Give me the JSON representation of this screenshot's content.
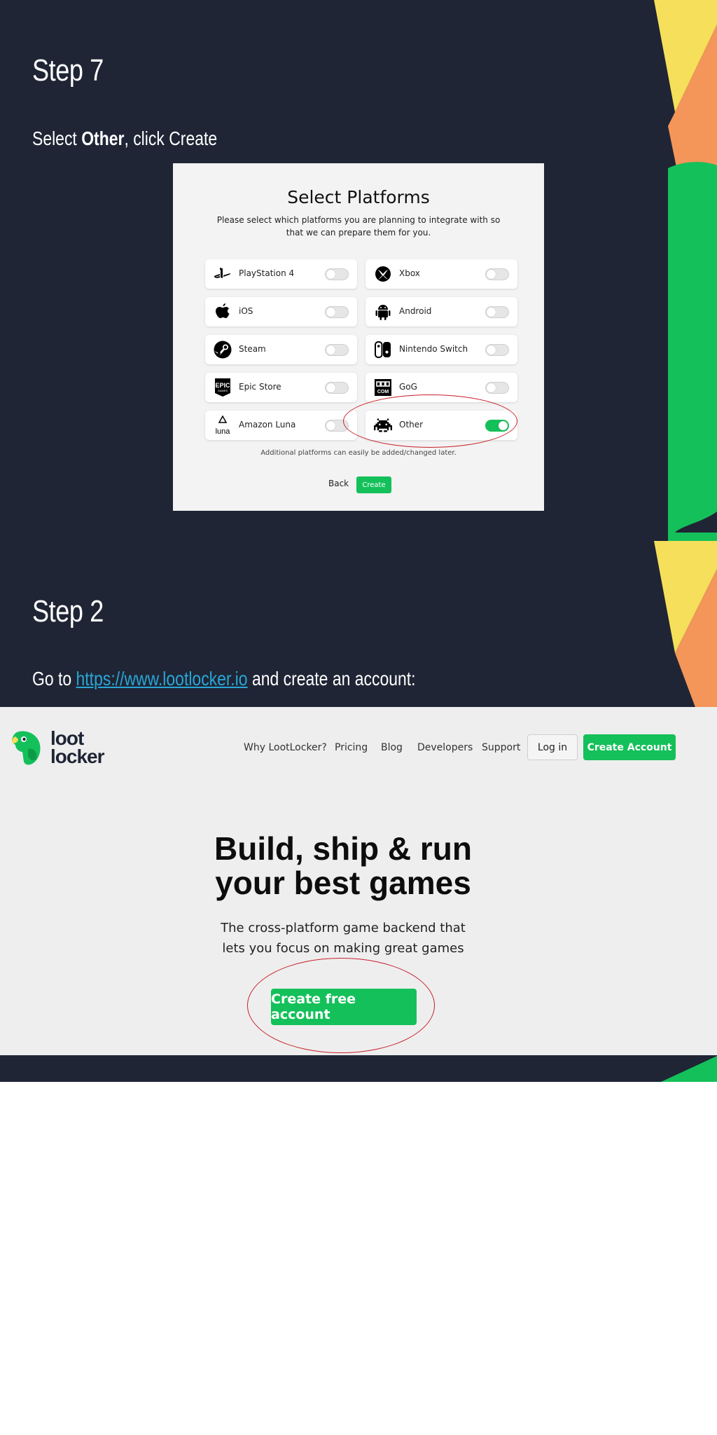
{
  "step7": {
    "title": "Step 7",
    "text_prefix": "Select ",
    "text_bold": "Other",
    "text_suffix": ", click Create",
    "panel": {
      "title": "Select Platforms",
      "description": "Please select which platforms you are planning to integrate with so that we can prepare them for you.",
      "platforms": [
        {
          "label": "PlayStation 4",
          "icon": "playstation-icon",
          "enabled": false
        },
        {
          "label": "Xbox",
          "icon": "xbox-icon",
          "enabled": false
        },
        {
          "label": "iOS",
          "icon": "apple-icon",
          "enabled": false
        },
        {
          "label": "Android",
          "icon": "android-icon",
          "enabled": false
        },
        {
          "label": "Steam",
          "icon": "steam-icon",
          "enabled": false
        },
        {
          "label": "Nintendo Switch",
          "icon": "nintendo-switch-icon",
          "enabled": false
        },
        {
          "label": "Epic Store",
          "icon": "epic-games-icon",
          "enabled": false
        },
        {
          "label": "GoG",
          "icon": "gog-icon",
          "enabled": false
        },
        {
          "label": "Amazon Luna",
          "icon": "amazon-luna-icon",
          "enabled": false
        },
        {
          "label": "Other",
          "icon": "space-invader-icon",
          "enabled": true
        }
      ],
      "note": "Additional platforms can easily be added/changed later.",
      "back_label": "Back",
      "create_label": "Create"
    }
  },
  "step2": {
    "title": "Step 2",
    "text_prefix": "Go to ",
    "link": "https://www.lootlocker.io",
    "text_suffix": " and create an account:",
    "site": {
      "logo_line1": "loot",
      "logo_line2": "locker",
      "nav": [
        "Why LootLocker?",
        "Pricing",
        "Blog",
        "Developers",
        "Support"
      ],
      "login_label": "Log in",
      "create_account_label": "Create Account",
      "headline_line1": "Build, ship & run",
      "headline_line2": "your best games",
      "subline_line1": "The cross-platform game backend that",
      "subline_line2": "lets you focus on making great games",
      "cta_label": "Create free account"
    }
  },
  "colors": {
    "slide_bg": "#1f2535",
    "accent_green": "#14c05a",
    "deco_yellow": "#f6df5a",
    "deco_orange": "#f4955a",
    "link_blue": "#2aa6d6",
    "highlight_ring": "#c8202a"
  }
}
